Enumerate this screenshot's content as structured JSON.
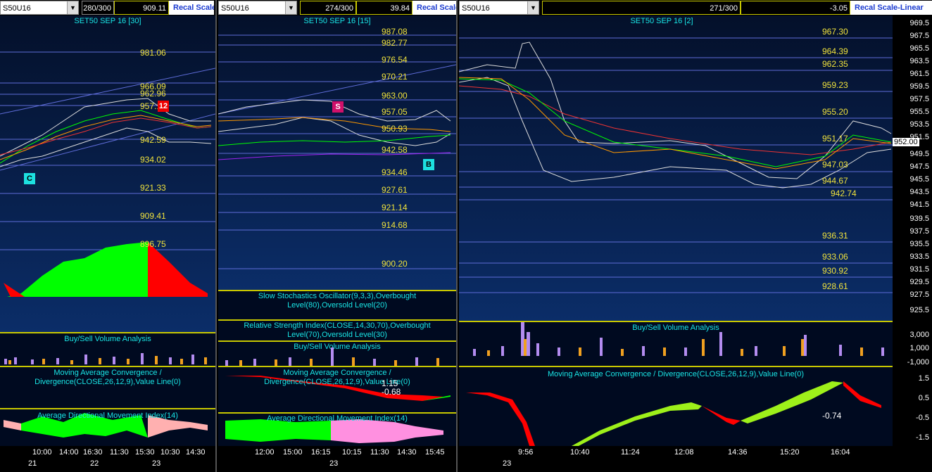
{
  "panels": [
    {
      "symbol": "S50U16",
      "bars": "280/300",
      "value": "909.11",
      "rescale": "Recal Scale",
      "title": "SET50 SEP 16  [30]",
      "levels": [
        "981.06",
        "966.09",
        "962.96",
        "957.12",
        "942.59",
        "934.02",
        "921.33",
        "909.41",
        "896.75"
      ],
      "markers": {
        "sell": "12",
        "buy": "C"
      },
      "volume_title": "Buy/Sell Volume Analysis",
      "macd_title": "Moving Average Convergence / Divergence(CLOSE,26,12,9),Value Line(0)",
      "adx_title": "Average Directional Movement Index(14)",
      "times": [
        "10:00",
        "14:00",
        "16:30",
        "11:30",
        "15:30",
        "10:30",
        "14:30"
      ],
      "dates": [
        "21",
        "22",
        "23"
      ]
    },
    {
      "symbol": "S50U16",
      "bars": "274/300",
      "value": "39.84",
      "rescale": "Recal Scale",
      "title": "SET50 SEP 16  [15]",
      "levels": [
        "987.08",
        "982.77",
        "976.54",
        "970.21",
        "963.00",
        "957.05",
        "950.93",
        "942.58",
        "934.46",
        "927.61",
        "921.14",
        "914.68",
        "900.20"
      ],
      "markers": {
        "sell": "S",
        "buy": "B"
      },
      "stoch_title": "Slow Stochastics Oscillator(9,3,3),Overbought Level(80),Oversold Level(20)",
      "rsi_title": "Relative Strength Index(CLOSE,14,30,70),Overbought Level(70),Oversold Level(30)",
      "volume_title": "Buy/Sell Volume Analysis",
      "macd_title": "Moving Average Convergence / Divergence(CLOSE,26,12,9),Value Line(0)",
      "macd_values": [
        "1.15",
        "-0.68"
      ],
      "adx_title": "Average Directional Movement Index(14)",
      "times": [
        "12:00",
        "15:00",
        "16:15",
        "10:15",
        "11:30",
        "14:30",
        "15:45"
      ],
      "dates": [
        "23"
      ]
    },
    {
      "symbol": "S50U16",
      "bars": "271/300",
      "value": "-3.05",
      "rescale": "Recal Scale-Linear",
      "title": "SET50 SEP 16  [2]",
      "levels": [
        "967.30",
        "964.39",
        "962.35",
        "959.23",
        "955.20",
        "951.17",
        "947.03",
        "944.67",
        "942.74",
        "936.31",
        "933.06",
        "930.92",
        "928.61"
      ],
      "last_price": "952.00",
      "yaxis": [
        "969.5",
        "967.5",
        "965.5",
        "963.5",
        "961.5",
        "959.5",
        "957.5",
        "955.5",
        "953.5",
        "951.5",
        "949.5",
        "947.5",
        "945.5",
        "943.5",
        "941.5",
        "939.5",
        "937.5",
        "935.5",
        "933.5",
        "931.5",
        "929.5",
        "927.5",
        "925.5"
      ],
      "volume_title": "Buy/Sell Volume Analysis",
      "volume_axis": [
        "3,000",
        "1,000",
        "-1,000"
      ],
      "macd_title": "Moving Average Convergence / Divergence(CLOSE,26,12,9),Value Line(0)",
      "macd_value": "-0.74",
      "macd_axis": [
        "1.5",
        "0.5",
        "-0.5",
        "-1.5"
      ],
      "times": [
        "9:56",
        "10:40",
        "11:24",
        "12:08",
        "14:36",
        "15:20",
        "16:04"
      ],
      "dates": [
        "23"
      ]
    }
  ],
  "colors": {
    "bull": "#00ff00",
    "bear": "#ff0000",
    "level": "#f0e23c",
    "title": "#19e6e6",
    "separator": "#c8c800"
  }
}
